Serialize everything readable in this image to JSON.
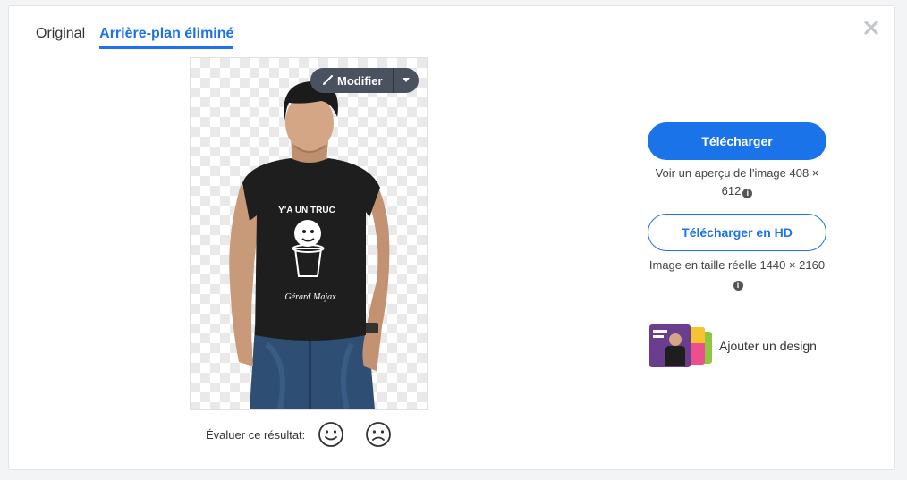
{
  "tabs": [
    {
      "label": "Original"
    },
    {
      "label": "Arrière-plan éliminé",
      "active": true
    }
  ],
  "preview": {
    "edit_label": "Modifier",
    "shirt_text": "Y'A UN TRUC",
    "shirt_signature": "Gérard Majax"
  },
  "rating": {
    "label": "Évaluer ce résultat:"
  },
  "download": {
    "label": "Télécharger",
    "note": "Voir un aperçu de l'image 408 × 612"
  },
  "download_hd": {
    "label": "Télécharger en HD",
    "note": "Image en taille réelle 1440 × 2160"
  },
  "add_design": {
    "label": "Ajouter un design"
  },
  "colors": {
    "accent": "#1a73e8",
    "edit_button": "#4a5260",
    "checker": "#e9e9e9"
  }
}
